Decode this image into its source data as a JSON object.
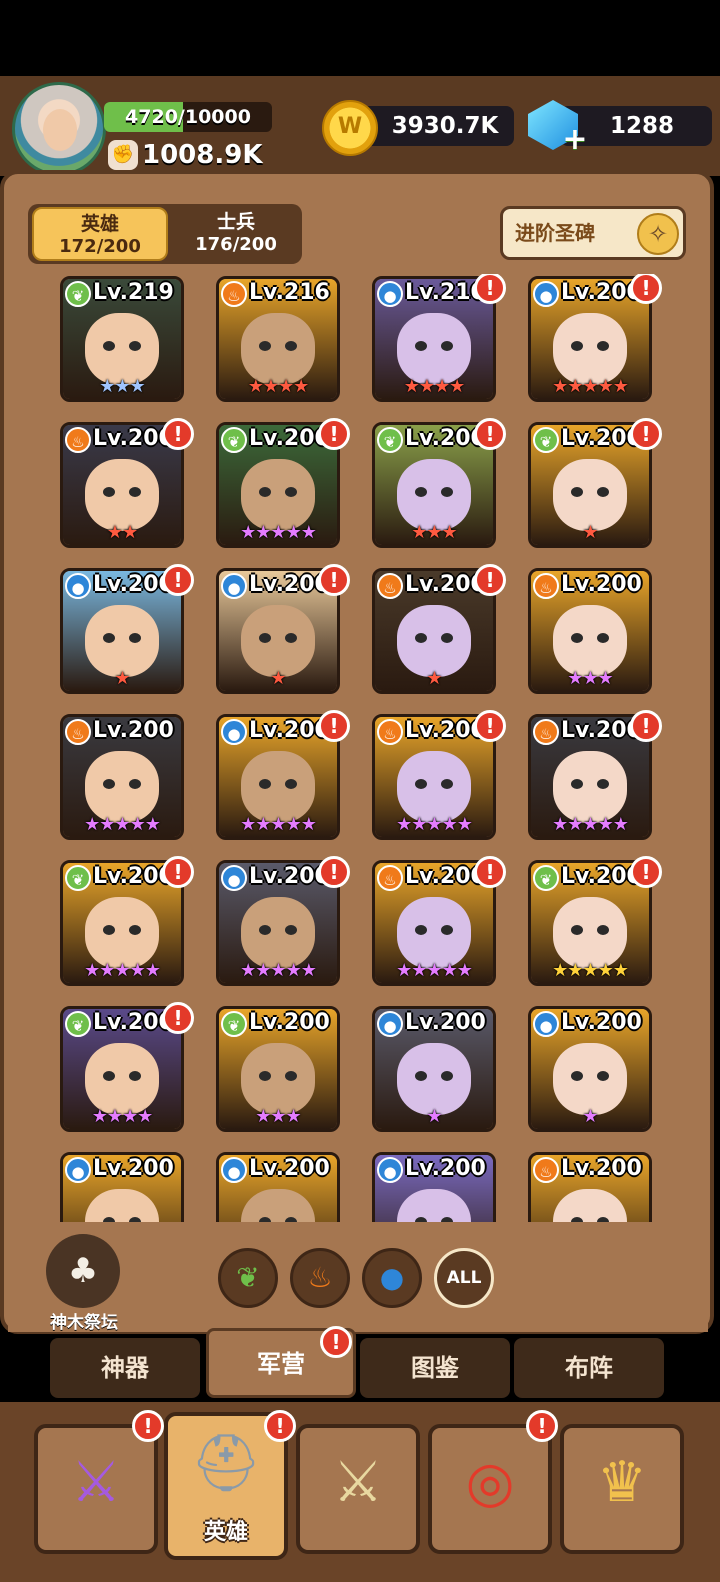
{
  "player": {
    "xp_text": "4720/10000",
    "xp_progress": 0.472,
    "power": "1008.9K"
  },
  "currency": {
    "gold": "3930.7K",
    "gems": "1288",
    "gem_plus": "+"
  },
  "tabs": {
    "heroes_label": "英雄",
    "heroes_count": "172/200",
    "soldiers_label": "士兵",
    "soldiers_count": "176/200"
  },
  "advance_button": {
    "label": "进阶圣碑"
  },
  "colors": {
    "leaf": "#6fbf4a",
    "fire": "#f07a1a",
    "water": "#2e86d8",
    "alert": "#e33a2a"
  },
  "heroes": [
    {
      "element": "leaf",
      "level": "Lv.219",
      "stars": "★★★",
      "star_color": "blue",
      "alert": false,
      "bg": "#3a4a3a"
    },
    {
      "element": "fire",
      "level": "Lv.216",
      "stars": "★★★★",
      "star_color": "red",
      "alert": false,
      "bg": "#e8a52a"
    },
    {
      "element": "water",
      "level": "Lv.210",
      "stars": "★★★★",
      "star_color": "red",
      "alert": true,
      "bg": "#6a5a9a"
    },
    {
      "element": "water",
      "level": "Lv.200",
      "stars": "★★★★★",
      "star_color": "red",
      "alert": true,
      "bg": "#e8a52a"
    },
    {
      "element": "fire",
      "level": "Lv.200",
      "stars": "★★",
      "star_color": "red",
      "alert": true,
      "bg": "#3a3a4a"
    },
    {
      "element": "leaf",
      "level": "Lv.200",
      "stars": "★★★★★",
      "star_color": "purple",
      "alert": true,
      "bg": "#3c6a3a"
    },
    {
      "element": "leaf",
      "level": "Lv.200",
      "stars": "★★★",
      "star_color": "red",
      "alert": true,
      "bg": "#8aa04a"
    },
    {
      "element": "leaf",
      "level": "Lv.200",
      "stars": "★",
      "star_color": "red",
      "alert": true,
      "bg": "#e8a52a"
    },
    {
      "element": "water",
      "level": "Lv.200",
      "stars": "★",
      "star_color": "red",
      "alert": true,
      "bg": "#7ab8e0"
    },
    {
      "element": "water",
      "level": "Lv.200",
      "stars": "★",
      "star_color": "red",
      "alert": true,
      "bg": "#e8c89a"
    },
    {
      "element": "fire",
      "level": "Lv.200",
      "stars": "★",
      "star_color": "red",
      "alert": true,
      "bg": "#4a3a2a"
    },
    {
      "element": "fire",
      "level": "Lv.200",
      "stars": "★★★",
      "star_color": "purple",
      "alert": false,
      "bg": "#e8a52a"
    },
    {
      "element": "fire",
      "level": "Lv.200",
      "stars": "★★★★★",
      "star_color": "purple",
      "alert": false,
      "bg": "#3a3a40"
    },
    {
      "element": "water",
      "level": "Lv.200",
      "stars": "★★★★★",
      "star_color": "purple",
      "alert": true,
      "bg": "#e8a52a"
    },
    {
      "element": "fire",
      "level": "Lv.200",
      "stars": "★★★★★",
      "star_color": "purple",
      "alert": true,
      "bg": "#e8a52a"
    },
    {
      "element": "fire",
      "level": "Lv.200",
      "stars": "★★★★★",
      "star_color": "purple",
      "alert": true,
      "bg": "#3a3a40"
    },
    {
      "element": "leaf",
      "level": "Lv.200",
      "stars": "★★★★★",
      "star_color": "purple",
      "alert": true,
      "bg": "#e8a52a"
    },
    {
      "element": "water",
      "level": "Lv.200",
      "stars": "★★★★★",
      "star_color": "purple",
      "alert": true,
      "bg": "#5a5a6a"
    },
    {
      "element": "fire",
      "level": "Lv.200",
      "stars": "★★★★★",
      "star_color": "purple",
      "alert": true,
      "bg": "#e8a52a"
    },
    {
      "element": "leaf",
      "level": "Lv.200",
      "stars": "★★★★★",
      "star_color": "gold",
      "alert": true,
      "bg": "#e8a52a"
    },
    {
      "element": "leaf",
      "level": "Lv.200",
      "stars": "★★★★",
      "star_color": "purple",
      "alert": true,
      "bg": "#5a4a8a"
    },
    {
      "element": "leaf",
      "level": "Lv.200",
      "stars": "★★★",
      "star_color": "purple",
      "alert": false,
      "bg": "#e8a52a"
    },
    {
      "element": "water",
      "level": "Lv.200",
      "stars": "★",
      "star_color": "purple",
      "alert": false,
      "bg": "#5a5a6a"
    },
    {
      "element": "water",
      "level": "Lv.200",
      "stars": "★",
      "star_color": "purple",
      "alert": false,
      "bg": "#e8a52a"
    },
    {
      "element": "water",
      "level": "Lv.200",
      "stars": "",
      "star_color": "red",
      "alert": false,
      "bg": "#e8a52a"
    },
    {
      "element": "water",
      "level": "Lv.200",
      "stars": "",
      "star_color": "red",
      "alert": false,
      "bg": "#e8a52a"
    },
    {
      "element": "water",
      "level": "Lv.200",
      "stars": "",
      "star_color": "red",
      "alert": false,
      "bg": "#7a6ac0"
    },
    {
      "element": "fire",
      "level": "Lv.200",
      "stars": "",
      "star_color": "red",
      "alert": false,
      "bg": "#e8a52a"
    }
  ],
  "altar": {
    "label": "神木祭坛"
  },
  "filters": {
    "all_label": "ALL"
  },
  "subtabs": [
    "神器",
    "军营",
    "图鉴",
    "布阵"
  ],
  "nav": {
    "heroes_label": "英雄"
  }
}
